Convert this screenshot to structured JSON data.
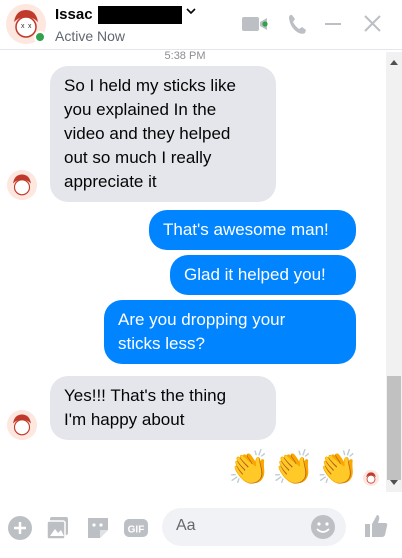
{
  "header": {
    "contact_name": "Issac",
    "status": "Active Now"
  },
  "conversation": {
    "timestamp": "5:38 PM",
    "messages": [
      {
        "direction": "in",
        "text_lines": [
          "So I held my sticks like",
          "you explained In the",
          "video and they helped",
          "out so much I really",
          "appreciate it"
        ]
      },
      {
        "direction": "out",
        "text_lines": [
          "That's awesome man!"
        ]
      },
      {
        "direction": "out",
        "text_lines": [
          "Glad it helped you!"
        ]
      },
      {
        "direction": "out",
        "text_lines": [
          "Are you dropping your",
          "sticks less?"
        ]
      },
      {
        "direction": "in",
        "text_lines": [
          "Yes!!! That's the thing",
          "I'm happy about"
        ]
      }
    ],
    "reaction": {
      "emoji": "👏👏👏"
    }
  },
  "composer": {
    "placeholder": "Aa",
    "gif_label": "GIF"
  },
  "colors": {
    "outgoing_bubble": "#0084ff",
    "incoming_bubble": "#e4e6eb",
    "online": "#31a24c",
    "icon": "#bcc0c4"
  },
  "icons": [
    "video-camera-icon",
    "phone-icon",
    "minimize-icon",
    "close-icon",
    "plus-icon",
    "image-icon",
    "sticker-icon",
    "gif-icon",
    "emoji-icon",
    "like-icon"
  ]
}
